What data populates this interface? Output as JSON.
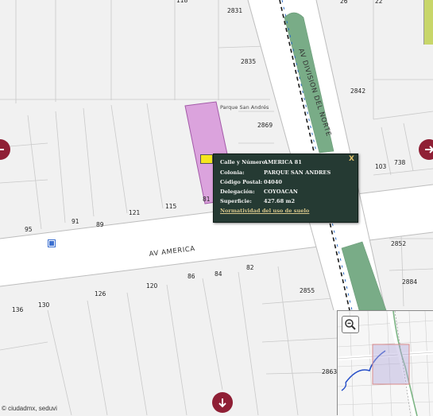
{
  "map": {
    "street_labels": {
      "av_america": "AV AMERICA",
      "av_division_del_norte": "AV DIVISION DEL NORTE"
    },
    "place_label": "Parque San Andrés",
    "house_numbers": [
      "118",
      "2831",
      "2835",
      "2869",
      "26",
      "22",
      "2842",
      "103",
      "738",
      "95",
      "91",
      "89",
      "121",
      "115",
      "81",
      "2852",
      "2884",
      "86",
      "84",
      "82",
      "120",
      "126",
      "130",
      "136",
      "2855",
      "2863"
    ]
  },
  "info_popup": {
    "close_label": "X",
    "rows": [
      {
        "key": "Calle y Número:",
        "value": "AMERICA 81"
      },
      {
        "key": "Colonia:",
        "value": "PARQUE SAN ANDRES"
      },
      {
        "key": "Código Postal:",
        "value": "04040"
      },
      {
        "key": "Delegación:",
        "value": "COYOACAN"
      },
      {
        "key": "Superficie:",
        "value": "427.68 m2"
      }
    ],
    "link_label": "Normatividad del uso de suelo"
  },
  "navigation": {
    "pan_left": "arrow-left-icon",
    "pan_right": "arrow-right-icon",
    "pan_down": "arrow-down-icon"
  },
  "overview": {
    "zoom_icon": "magnifier-zoom-out-icon"
  },
  "attribution": "© ciudadmx, seduvi",
  "colors": {
    "nav_button": "#8f1f35",
    "popup_bg": "#253a33",
    "lot_highlight": "#dba3dd",
    "median_green": "#79ac87",
    "marker_yellow": "#f5e61c"
  }
}
